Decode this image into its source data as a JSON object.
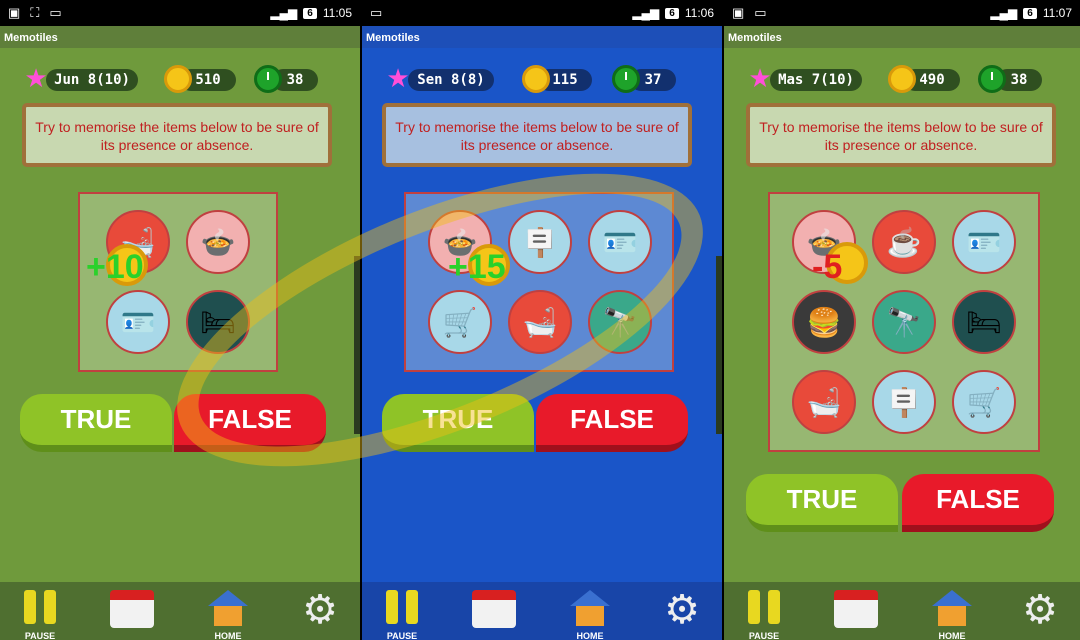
{
  "panels": [
    {
      "status": {
        "battery": "6",
        "time": "11:05"
      },
      "app_title": "Memotiles",
      "stats": {
        "level": "Jun 8(10)",
        "coins": "510",
        "timer": "38"
      },
      "message": "Try to memorise the items below to be sure of its presence or absence.",
      "bonus": "+10",
      "true_label": "TRUE",
      "false_label": "FALSE",
      "tiles": [
        "bathtub",
        "cooking-pot",
        "id-card",
        "bed"
      ]
    },
    {
      "status": {
        "battery": "6",
        "time": "11:06"
      },
      "app_title": "Memotiles",
      "stats": {
        "level": "Sen 8(8)",
        "coins": "115",
        "timer": "37"
      },
      "message": "Try to memorise the items below to be sure of its presence or absence.",
      "bonus": "+15",
      "true_label": "TRUE",
      "false_label": "FALSE",
      "tiles": [
        "cooking-pot",
        "signpost",
        "id-card",
        "stroller",
        "bathtub",
        "binoculars"
      ]
    },
    {
      "status": {
        "battery": "6",
        "time": "11:07"
      },
      "app_title": "Memotiles",
      "stats": {
        "level": "Mas 7(10)",
        "coins": "490",
        "timer": "38"
      },
      "message": "Try to memorise the items below to be sure of its presence or absence.",
      "bonus": "-5",
      "true_label": "TRUE",
      "false_label": "FALSE",
      "tiles": [
        "cooking-pot",
        "coffee-machine",
        "id-card",
        "burger",
        "binoculars",
        "bed",
        "bathtub",
        "signpost",
        "stroller"
      ]
    }
  ],
  "bottom_nav": {
    "pause": "PAUSE",
    "shop": "SHOP",
    "home": "HOME",
    "settings": ""
  },
  "colors": {
    "green_bg": "#6f9a3c",
    "blue_bg": "#1a55c8",
    "true_btn": "#8fc327",
    "false_btn": "#e81a2a",
    "message_text": "#c02020"
  }
}
